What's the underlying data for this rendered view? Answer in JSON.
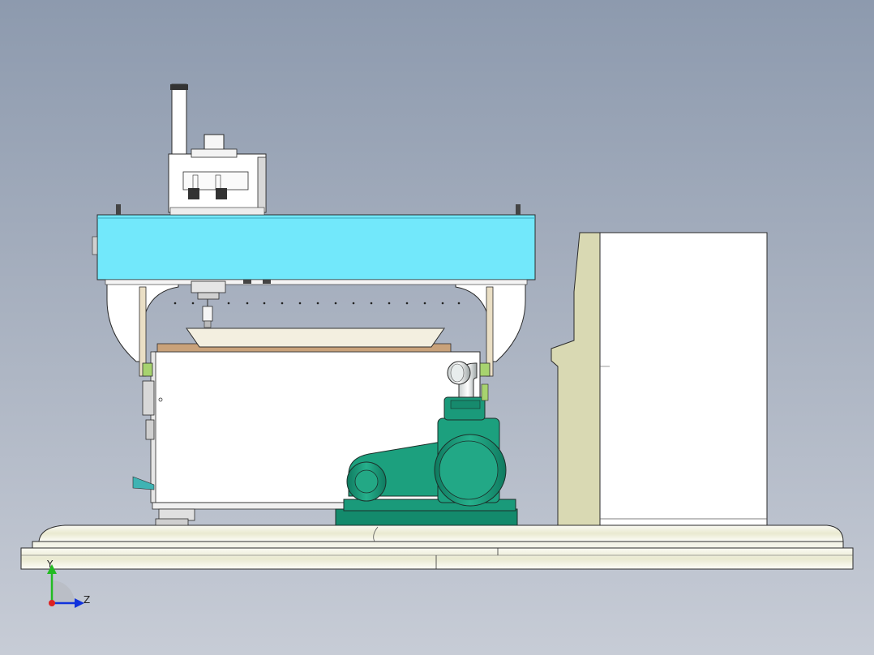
{
  "viewport": {
    "background_top": "#8d9aae",
    "background_bottom": "#c7ccd6"
  },
  "colors": {
    "gantry_beam": "#72e8fb",
    "vacuum_pump": "#1a9a7a",
    "base_plate": "#f2f2e4",
    "cabinet_side": "#d9d9b3",
    "cabinet_front": "#ffffff",
    "outline": "#2b2b2b"
  },
  "triad": {
    "y_label": "Y",
    "z_label": "Z",
    "y_color": "#22bb22",
    "z_color": "#1133dd",
    "x_color": "#dd2222"
  }
}
